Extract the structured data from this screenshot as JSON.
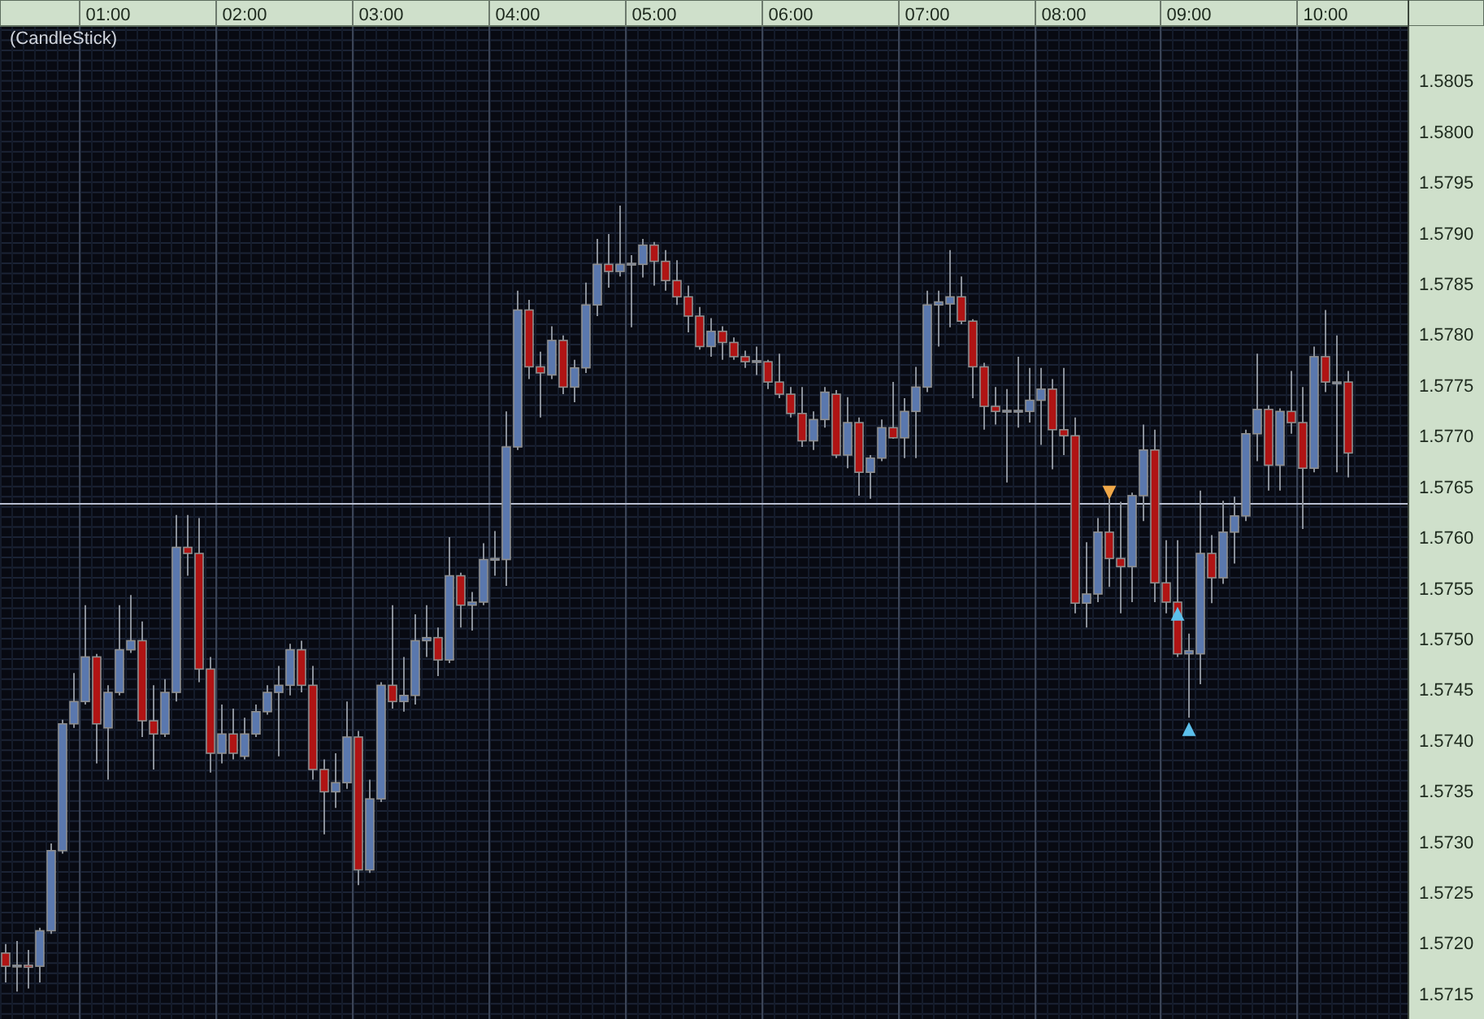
{
  "chart": {
    "title": "(CandleStick)",
    "chart_data": {
      "type": "candlestick",
      "grid": true,
      "categories": [
        null,
        null,
        null,
        null,
        null,
        null,
        null,
        null,
        null,
        "01:00",
        null,
        null,
        null,
        null,
        null,
        null,
        null,
        null,
        null,
        null,
        null,
        "02:00",
        null,
        null,
        null,
        null,
        null,
        null,
        null,
        null,
        null,
        null,
        null,
        "03:00",
        null,
        null,
        null,
        null,
        null,
        null,
        null,
        null,
        null,
        null,
        null,
        "04:00",
        null,
        null,
        null,
        null,
        null,
        null,
        null,
        null,
        null,
        null,
        null,
        "05:00",
        null,
        null,
        null,
        null,
        null,
        null,
        null,
        null,
        null,
        null,
        null,
        "06:00",
        null,
        null,
        null,
        null,
        null,
        null,
        null,
        null,
        null,
        null,
        null,
        "07:00",
        null,
        null,
        null,
        null,
        null,
        null,
        null,
        null,
        null,
        null,
        null,
        "08:00",
        null,
        null,
        null,
        null,
        null,
        null,
        null,
        null,
        null,
        null,
        "09:00",
        null,
        null,
        null,
        null,
        null,
        null,
        null,
        null,
        null,
        null,
        null,
        "10:00",
        null,
        null
      ],
      "ohlc": [
        [
          1.5719,
          1.57199,
          1.57161,
          1.57177
        ],
        [
          1.57177,
          1.57202,
          1.57152,
          1.57178
        ],
        [
          1.57178,
          1.57193,
          1.57155,
          1.57176
        ],
        [
          1.57177,
          1.57215,
          1.57161,
          1.57212
        ],
        [
          1.57212,
          1.57298,
          1.57209,
          1.57291
        ],
        [
          1.57291,
          1.5742,
          1.57288,
          1.57416
        ],
        [
          1.57416,
          1.57466,
          1.57412,
          1.57438
        ],
        [
          1.57438,
          1.57533,
          1.57435,
          1.57482
        ],
        [
          1.57482,
          1.57485,
          1.57377,
          1.57416
        ],
        [
          1.57412,
          1.57454,
          1.57361,
          1.57447
        ],
        [
          1.57447,
          1.57533,
          1.57444,
          1.57489
        ],
        [
          1.57489,
          1.57543,
          1.57486,
          1.57498
        ],
        [
          1.57498,
          1.57517,
          1.57403,
          1.57419
        ],
        [
          1.57419,
          1.57454,
          1.57371,
          1.57406
        ],
        [
          1.57406,
          1.5746,
          1.57403,
          1.57447
        ],
        [
          1.57447,
          1.57622,
          1.57438,
          1.5759
        ],
        [
          1.5759,
          1.57622,
          1.57562,
          1.57584
        ],
        [
          1.57584,
          1.57619,
          1.57457,
          1.5747
        ],
        [
          1.5747,
          1.57482,
          1.57368,
          1.57387
        ],
        [
          1.57387,
          1.57435,
          1.57377,
          1.57406
        ],
        [
          1.57406,
          1.57431,
          1.57381,
          1.57387
        ],
        [
          1.57384,
          1.57422,
          1.57381,
          1.57406
        ],
        [
          1.57406,
          1.57435,
          1.57403,
          1.57428
        ],
        [
          1.57428,
          1.57454,
          1.57425,
          1.57447
        ],
        [
          1.57447,
          1.57473,
          1.57384,
          1.57454
        ],
        [
          1.57454,
          1.57495,
          1.57444,
          1.57489
        ],
        [
          1.57489,
          1.57498,
          1.57447,
          1.57454
        ],
        [
          1.57454,
          1.57473,
          1.57361,
          1.57371
        ],
        [
          1.57371,
          1.57381,
          1.57307,
          1.57349
        ],
        [
          1.57349,
          1.57387,
          1.57333,
          1.57358
        ],
        [
          1.57358,
          1.57438,
          1.57352,
          1.57403
        ],
        [
          1.57403,
          1.57409,
          1.57257,
          1.57272
        ],
        [
          1.57272,
          1.57361,
          1.57269,
          1.57342
        ],
        [
          1.57342,
          1.57457,
          1.57339,
          1.57454
        ],
        [
          1.57454,
          1.57533,
          1.57431,
          1.57438
        ],
        [
          1.57438,
          1.57482,
          1.57428,
          1.57444
        ],
        [
          1.57444,
          1.57524,
          1.57435,
          1.57498
        ],
        [
          1.57498,
          1.57533,
          1.57482,
          1.57501
        ],
        [
          1.57501,
          1.57511,
          1.57463,
          1.57479
        ],
        [
          1.57479,
          1.576,
          1.57476,
          1.57562
        ],
        [
          1.57562,
          1.57565,
          1.57511,
          1.57533
        ],
        [
          1.57533,
          1.57546,
          1.57508,
          1.57536
        ],
        [
          1.57536,
          1.57594,
          1.57533,
          1.57578
        ],
        [
          1.57578,
          1.57606,
          1.57562,
          1.57579
        ],
        [
          1.57578,
          1.57724,
          1.57552,
          1.57689
        ],
        [
          1.57689,
          1.57843,
          1.57686,
          1.57824
        ],
        [
          1.57824,
          1.57834,
          1.57756,
          1.57768
        ],
        [
          1.57768,
          1.57783,
          1.57718,
          1.57762
        ],
        [
          1.5776,
          1.57808,
          1.57756,
          1.57794
        ],
        [
          1.57794,
          1.57799,
          1.57741,
          1.57748
        ],
        [
          1.57748,
          1.57775,
          1.57733,
          1.57767
        ],
        [
          1.57767,
          1.57851,
          1.57762,
          1.57829
        ],
        [
          1.57829,
          1.57894,
          1.57818,
          1.57869
        ],
        [
          1.57869,
          1.57899,
          1.57846,
          1.57862
        ],
        [
          1.57862,
          1.57927,
          1.57857,
          1.57869
        ],
        [
          1.57869,
          1.57878,
          1.57807,
          1.5787
        ],
        [
          1.57869,
          1.57894,
          1.57856,
          1.57888
        ],
        [
          1.57888,
          1.57891,
          1.57848,
          1.57872
        ],
        [
          1.57872,
          1.57883,
          1.57843,
          1.57853
        ],
        [
          1.57853,
          1.57873,
          1.57829,
          1.57837
        ],
        [
          1.57837,
          1.57848,
          1.57802,
          1.57818
        ],
        [
          1.57818,
          1.57827,
          1.57785,
          1.57788
        ],
        [
          1.57788,
          1.57816,
          1.57778,
          1.57803
        ],
        [
          1.57803,
          1.57808,
          1.57775,
          1.57792
        ],
        [
          1.57792,
          1.57797,
          1.57775,
          1.57778
        ],
        [
          1.57778,
          1.57784,
          1.57767,
          1.57773
        ],
        [
          1.57773,
          1.57788,
          1.5776,
          1.57774
        ],
        [
          1.57773,
          1.57775,
          1.57746,
          1.57753
        ],
        [
          1.57753,
          1.57781,
          1.57737,
          1.57741
        ],
        [
          1.57741,
          1.57748,
          1.57718,
          1.57722
        ],
        [
          1.57722,
          1.57748,
          1.57689,
          1.57695
        ],
        [
          1.57695,
          1.57724,
          1.57686,
          1.57716
        ],
        [
          1.57716,
          1.57748,
          1.57708,
          1.57743
        ],
        [
          1.57741,
          1.57745,
          1.57678,
          1.57681
        ],
        [
          1.57681,
          1.57738,
          1.57668,
          1.57713
        ],
        [
          1.57713,
          1.57718,
          1.57641,
          1.57664
        ],
        [
          1.57664,
          1.57681,
          1.57638,
          1.57678
        ],
        [
          1.57678,
          1.57716,
          1.57675,
          1.57708
        ],
        [
          1.57708,
          1.57753,
          1.57697,
          1.57698
        ],
        [
          1.57698,
          1.57737,
          1.57678,
          1.57724
        ],
        [
          1.57724,
          1.57768,
          1.57678,
          1.57748
        ],
        [
          1.57748,
          1.57843,
          1.57743,
          1.57829
        ],
        [
          1.57829,
          1.57843,
          1.57788,
          1.57832
        ],
        [
          1.5783,
          1.57883,
          1.57807,
          1.57837
        ],
        [
          1.57837,
          1.57857,
          1.5781,
          1.57813
        ],
        [
          1.57813,
          1.57815,
          1.57737,
          1.57768
        ],
        [
          1.57768,
          1.57772,
          1.57706,
          1.57729
        ],
        [
          1.57729,
          1.57748,
          1.57711,
          1.57724
        ],
        [
          1.57724,
          1.57746,
          1.57654,
          1.57725
        ],
        [
          1.57724,
          1.57778,
          1.57708,
          1.57725
        ],
        [
          1.57724,
          1.57767,
          1.57713,
          1.57735
        ],
        [
          1.57735,
          1.57767,
          1.57691,
          1.57746
        ],
        [
          1.57746,
          1.57756,
          1.57667,
          1.57706
        ],
        [
          1.57706,
          1.57767,
          1.57681,
          1.577
        ],
        [
          1.577,
          1.57718,
          1.57525,
          1.57535
        ],
        [
          1.57535,
          1.57595,
          1.57511,
          1.57544
        ],
        [
          1.57544,
          1.57619,
          1.57536,
          1.57605
        ],
        [
          1.57605,
          1.57638,
          1.57551,
          1.57579
        ],
        [
          1.57579,
          1.57635,
          1.57525,
          1.57571
        ],
        [
          1.57571,
          1.57644,
          1.57536,
          1.57641
        ],
        [
          1.57641,
          1.57711,
          1.57616,
          1.57686
        ],
        [
          1.57686,
          1.57706,
          1.57536,
          1.57555
        ],
        [
          1.57555,
          1.57597,
          1.57525,
          1.57536
        ],
        [
          1.57536,
          1.57597,
          1.57482,
          1.57485
        ],
        [
          1.57485,
          1.57505,
          1.57422,
          1.57488
        ],
        [
          1.57485,
          1.57646,
          1.57455,
          1.57584
        ],
        [
          1.57584,
          1.57602,
          1.57535,
          1.5756
        ],
        [
          1.5756,
          1.57636,
          1.57554,
          1.57605
        ],
        [
          1.57605,
          1.5764,
          1.57574,
          1.57621
        ],
        [
          1.57621,
          1.57706,
          1.57616,
          1.57702
        ],
        [
          1.57702,
          1.57781,
          1.57675,
          1.57726
        ],
        [
          1.57726,
          1.5773,
          1.57646,
          1.57671
        ],
        [
          1.57671,
          1.57727,
          1.57646,
          1.57724
        ],
        [
          1.57724,
          1.57764,
          1.57702,
          1.57713
        ],
        [
          1.57713,
          1.57748,
          1.57608,
          1.57668
        ],
        [
          1.57668,
          1.57788,
          1.57664,
          1.57778
        ],
        [
          1.57778,
          1.57824,
          1.57743,
          1.57753
        ],
        [
          1.57753,
          1.57799,
          1.57664,
          1.57753
        ],
        [
          1.57753,
          1.57764,
          1.57659,
          1.57683
        ]
      ],
      "ylim": [
        1.57125,
        1.58104
      ],
      "yticks": [
        {
          "value": 1.5805,
          "label": "1.5805"
        },
        {
          "value": 1.58,
          "label": "1.5800"
        },
        {
          "value": 1.5795,
          "label": "1.5795"
        },
        {
          "value": 1.579,
          "label": "1.5790"
        },
        {
          "value": 1.5785,
          "label": "1.5785"
        },
        {
          "value": 1.578,
          "label": "1.5780"
        },
        {
          "value": 1.5775,
          "label": "1.5775"
        },
        {
          "value": 1.577,
          "label": "1.5770"
        },
        {
          "value": 1.5765,
          "label": "1.5765"
        },
        {
          "value": 1.576,
          "label": "1.5760"
        },
        {
          "value": 1.5755,
          "label": "1.5755"
        },
        {
          "value": 1.575,
          "label": "1.5750"
        },
        {
          "value": 1.5745,
          "label": "1.5745"
        },
        {
          "value": 1.574,
          "label": "1.5740"
        },
        {
          "value": 1.5735,
          "label": "1.5735"
        },
        {
          "value": 1.573,
          "label": "1.5730"
        },
        {
          "value": 1.5725,
          "label": "1.5725"
        },
        {
          "value": 1.572,
          "label": "1.5720"
        },
        {
          "value": 1.5715,
          "label": "1.5715"
        }
      ],
      "ref_lines": [
        {
          "axis": "y",
          "value": 1.57633
        }
      ],
      "annotations": [
        {
          "y": 1.57638,
          "text": "▼"
        },
        {
          "y": 1.57536,
          "text": "▲"
        },
        {
          "y": 1.57422,
          "text": "▲"
        }
      ]
    }
  }
}
